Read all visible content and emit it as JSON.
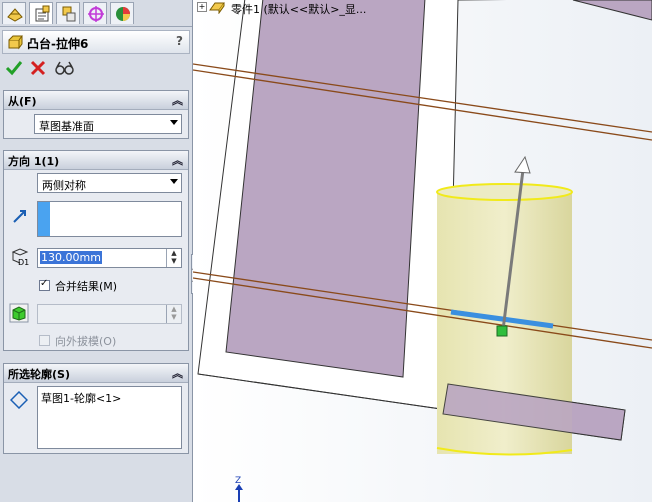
{
  "tabs": [
    {
      "name": "feature-manager-icon"
    },
    {
      "name": "property-manager-icon"
    },
    {
      "name": "configuration-manager-icon"
    },
    {
      "name": "dimxpert-icon"
    },
    {
      "name": "display-manager-icon"
    }
  ],
  "header": {
    "title": "凸台-拉伸6",
    "help": "?"
  },
  "actions": {
    "ok": "ok-check-icon",
    "cancel": "cancel-x-icon",
    "preview": "detailed-preview-icon"
  },
  "from_group": {
    "title": "从(F)",
    "combo_value": "草图基准面"
  },
  "direction_group": {
    "title": "方向 1(1)",
    "end_condition": "两侧对称",
    "depth": "130.00mm",
    "depth_symbol": "D1",
    "merge_label": "合并结果(M)",
    "merge_checked": true,
    "draft_label": "向外拔模(O)",
    "draft_checked": false
  },
  "contour_group": {
    "title": "所选轮廓(S)",
    "items": [
      "草图1-轮廓<1>"
    ]
  },
  "feature_tree": {
    "text": "零件1  (默认<<默认>_显..."
  },
  "triad": {
    "z_label": "Z"
  },
  "colors": {
    "panel_bg": "#d8dde6",
    "plane_fill": "#baa6c2",
    "cylinder": "#e9e7b5",
    "sketch_blue": "#3a8fe0",
    "axis_brown": "#8a4a1a"
  }
}
